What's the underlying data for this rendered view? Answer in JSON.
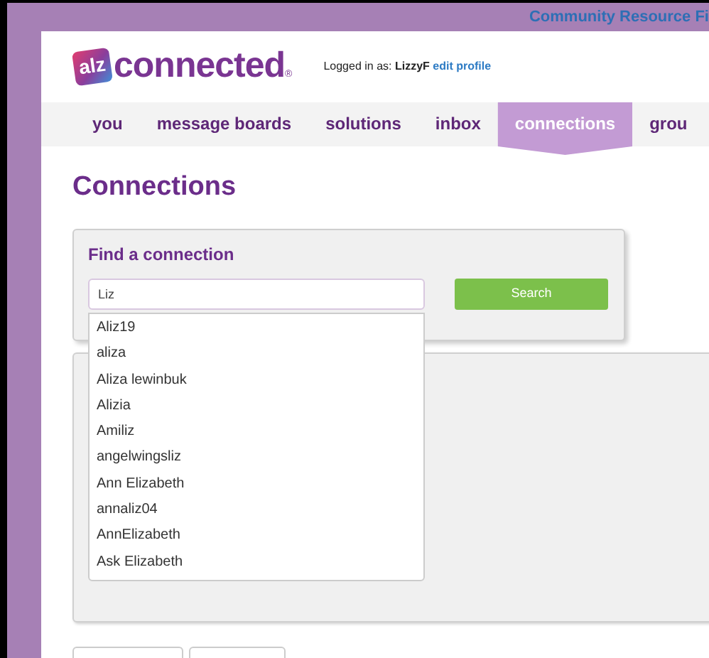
{
  "top_link": "Community Resource Fi",
  "logo": {
    "badge": "alz",
    "text": "connected",
    "mark": "®"
  },
  "login": {
    "label": "Logged in as:",
    "user": "LizzyF",
    "link": "edit profile"
  },
  "nav": [
    {
      "label": "you",
      "selected": false
    },
    {
      "label": "message boards",
      "selected": false
    },
    {
      "label": "solutions",
      "selected": false
    },
    {
      "label": "inbox",
      "selected": false
    },
    {
      "label": "connections",
      "selected": true
    },
    {
      "label": "grou",
      "selected": false
    }
  ],
  "heading": "Connections",
  "find": {
    "title": "Find a connection",
    "value": "Liz",
    "button": "Search",
    "suggestions": [
      "Aliz19",
      "aliza",
      "Aliza lewinbuk",
      "Alizia",
      "Amiliz",
      "angelwingsliz",
      "Ann Elizabeth",
      "annaliz04",
      "AnnElizabeth",
      "Ask Elizabeth"
    ]
  }
}
